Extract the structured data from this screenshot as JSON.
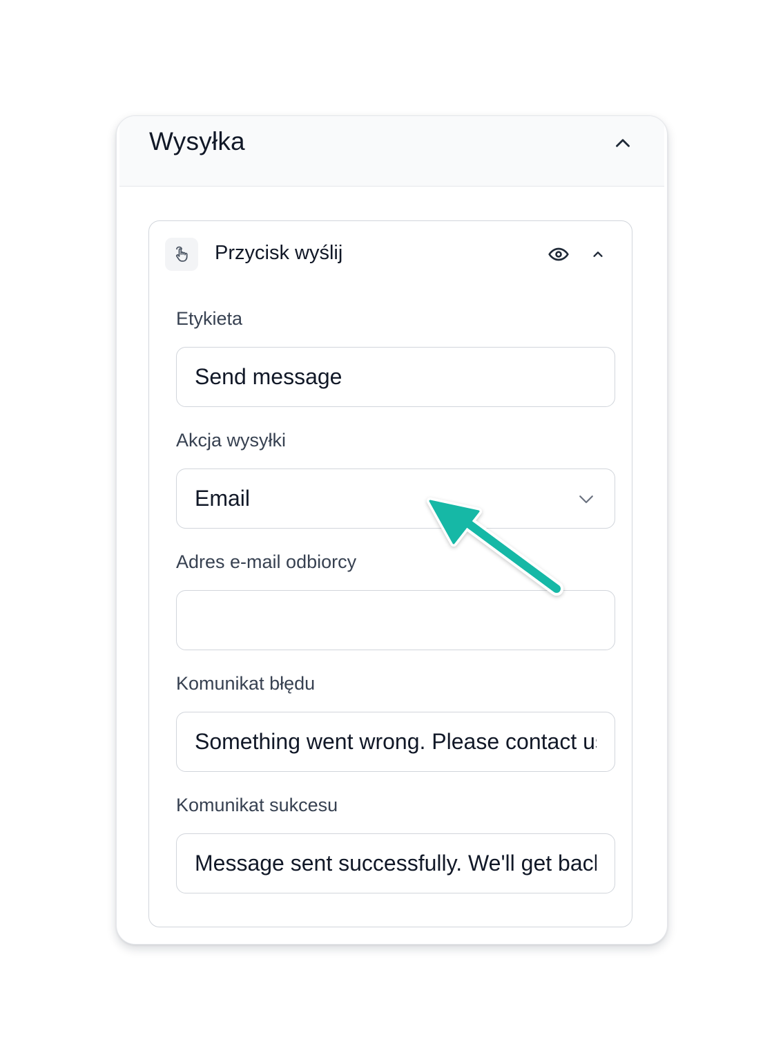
{
  "section": {
    "title": "Wysyłka",
    "collapse_icon": "chevron-up-icon"
  },
  "card": {
    "icon": "cursor-click-icon",
    "title": "Przycisk wyślij",
    "visibility_icon": "eye-icon",
    "collapse_icon": "chevron-up-icon"
  },
  "fields": {
    "label": {
      "label": "Etykieta",
      "value": "Send message"
    },
    "action": {
      "label": "Akcja wysyłki",
      "value": "Email",
      "icon": "chevron-down-icon"
    },
    "recipient": {
      "label": "Adres e-mail odbiorcy",
      "value": ""
    },
    "error": {
      "label": "Komunikat błędu",
      "value": "Something went wrong. Please contact us directly."
    },
    "success": {
      "label": "Komunikat sukcesu",
      "value": "Message sent successfully. We'll get back to you soon."
    }
  },
  "annotation": {
    "arrow_color": "#14b8a6"
  }
}
